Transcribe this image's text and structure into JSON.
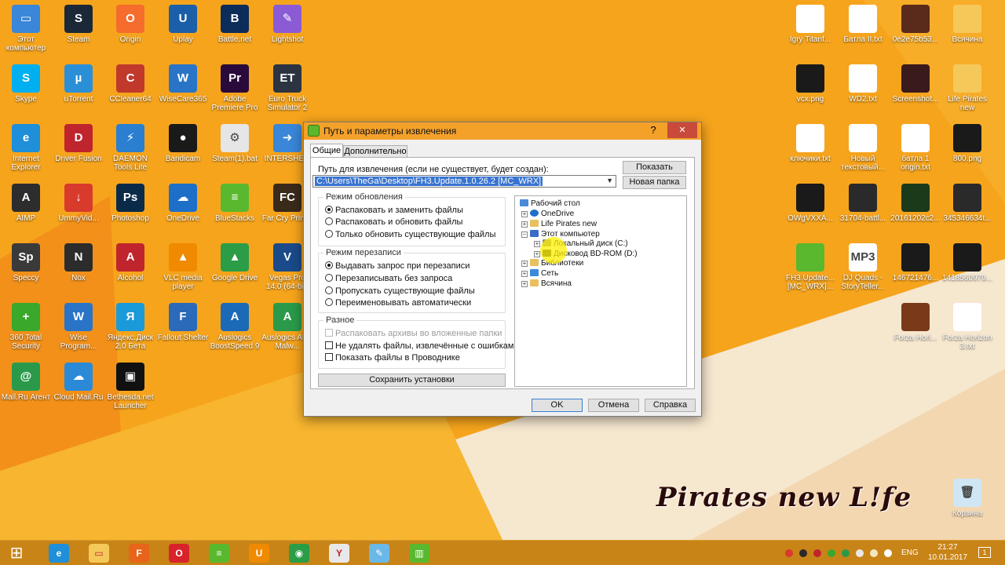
{
  "desktop": {
    "left_icons": [
      {
        "label": "Этот компьютер",
        "color": "#3a86d8",
        "glyph": "▭"
      },
      {
        "label": "Steam",
        "color": "#1b2838",
        "glyph": "S"
      },
      {
        "label": "Origin",
        "color": "#f56c2d",
        "glyph": "O"
      },
      {
        "label": "Uplay",
        "color": "#1a5fa8",
        "glyph": "U"
      },
      {
        "label": "Battle.net",
        "color": "#0c2c5a",
        "glyph": "B"
      },
      {
        "label": "Lightshot",
        "color": "#8b5bd6",
        "glyph": "✎"
      },
      {
        "label": "Skype",
        "color": "#00aff0",
        "glyph": "S"
      },
      {
        "label": "uTorrent",
        "color": "#2b8fd8",
        "glyph": "µ"
      },
      {
        "label": "CCleaner64",
        "color": "#c0392b",
        "glyph": "C"
      },
      {
        "label": "WiseCare365",
        "color": "#2a74c8",
        "glyph": "W"
      },
      {
        "label": "Adobe Premiere Pro",
        "color": "#2a0a3a",
        "glyph": "Pr"
      },
      {
        "label": "Euro Truck Simulator 2",
        "color": "#2b3440",
        "glyph": "ET"
      },
      {
        "label": "Internet Explorer",
        "color": "#1e8fd8",
        "glyph": "e"
      },
      {
        "label": "Driver Fusion",
        "color": "#c0242c",
        "glyph": "D"
      },
      {
        "label": "DAEMON Tools Lite",
        "color": "#2a7fd0",
        "glyph": "⚡"
      },
      {
        "label": "Bandicam",
        "color": "#1a1a1a",
        "glyph": "●"
      },
      {
        "label": "Steam(1).bat",
        "color": "#e6e6e6",
        "glyph": "⚙"
      },
      {
        "label": "INTERSHE...",
        "color": "#3a86d8",
        "glyph": "➜"
      },
      {
        "label": "AIMP",
        "color": "#2d2d2d",
        "glyph": "A"
      },
      {
        "label": "UmmyVid...",
        "color": "#d83a2c",
        "glyph": "↓"
      },
      {
        "label": "Photoshop",
        "color": "#0a2a4a",
        "glyph": "Ps"
      },
      {
        "label": "OneDrive",
        "color": "#1d6fc8",
        "glyph": "☁"
      },
      {
        "label": "BlueStacks",
        "color": "#5ab82e",
        "glyph": "≡"
      },
      {
        "label": "Far Cry Primal",
        "color": "#3a2a1a",
        "glyph": "FC"
      },
      {
        "label": "Speccy",
        "color": "#3a3a3a",
        "glyph": "Sp"
      },
      {
        "label": "Nox",
        "color": "#2c2c2c",
        "glyph": "N"
      },
      {
        "label": "Alcohol",
        "color": "#c0242c",
        "glyph": "A"
      },
      {
        "label": "VLC media player",
        "color": "#f08a00",
        "glyph": "▲"
      },
      {
        "label": "Google Drive",
        "color": "#2a9d46",
        "glyph": "▲"
      },
      {
        "label": "Vegas Pro 14.0 (64-bit)",
        "color": "#1a4a8a",
        "glyph": "V"
      },
      {
        "label": "360 Total Security",
        "color": "#3aa82a",
        "glyph": "+"
      },
      {
        "label": "Wise Program...",
        "color": "#2a74c8",
        "glyph": "W"
      },
      {
        "label": "Яндекс.Диск 2.0 Бета",
        "color": "#1a9ad8",
        "glyph": "Я"
      },
      {
        "label": "Fallout Shelter",
        "color": "#2a6ab8",
        "glyph": "F"
      },
      {
        "label": "Auslogics BoostSpeed 9",
        "color": "#1a6ab8",
        "glyph": "A"
      },
      {
        "label": "Auslogics Anti-Malw...",
        "color": "#2a9a4a",
        "glyph": "A"
      },
      {
        "label": "Mail.Ru Агент",
        "color": "#2a9a4a",
        "glyph": "@"
      },
      {
        "label": "Cloud Mail.Ru",
        "color": "#2a8ad8",
        "glyph": "☁"
      },
      {
        "label": "Bethesda.net Launcher",
        "color": "#111111",
        "glyph": "▣"
      }
    ],
    "right_icons": [
      {
        "label": "Igry Titanf...",
        "color": "#ffffff",
        "glyph": ""
      },
      {
        "label": "Батла II.txt",
        "color": "#ffffff",
        "glyph": ""
      },
      {
        "label": "0e2e75b53...",
        "color": "#5a2a1a",
        "glyph": ""
      },
      {
        "label": "Всячина",
        "color": "#f5c85a",
        "glyph": ""
      },
      {
        "label": "vcx.png",
        "color": "#1a1a1a",
        "glyph": ""
      },
      {
        "label": "WD2.txt",
        "color": "#ffffff",
        "glyph": ""
      },
      {
        "label": "Screenshot...",
        "color": "#3a1a1a",
        "glyph": ""
      },
      {
        "label": "Life Pirates new",
        "color": "#f5c85a",
        "glyph": ""
      },
      {
        "label": "ключики.txt",
        "color": "#ffffff",
        "glyph": ""
      },
      {
        "label": "Новый текстовый...",
        "color": "#ffffff",
        "glyph": ""
      },
      {
        "label": "батла 1 origin.txt",
        "color": "#ffffff",
        "glyph": ""
      },
      {
        "label": "800.png",
        "color": "#1a1a1a",
        "glyph": ""
      },
      {
        "label": "OWgVXXA...",
        "color": "#1a1a1a",
        "glyph": ""
      },
      {
        "label": "31704-battl...",
        "color": "#2a2a2a",
        "glyph": ""
      },
      {
        "label": "20161202c2...",
        "color": "#1a3a1a",
        "glyph": ""
      },
      {
        "label": "345346634t...",
        "color": "#2a2a2a",
        "glyph": ""
      },
      {
        "label": "FH3.Update... [MC_WRX]...",
        "color": "#5ab82e",
        "glyph": ""
      },
      {
        "label": "DJ Quads - StoryTeller...",
        "color": "#ffffff",
        "glyph": "MP3"
      },
      {
        "label": "146721476...",
        "color": "#1a1a1a",
        "glyph": ""
      },
      {
        "label": "1418560979...",
        "color": "#1a1a1a",
        "glyph": ""
      },
      {
        "label": "Forza Hori...",
        "color": "#7a3a1a",
        "glyph": ""
      },
      {
        "label": "Forza Horizon 3.txt",
        "color": "#ffffff",
        "glyph": ""
      },
      {
        "label": "Корзина",
        "color": "#cfe6f5",
        "glyph": "🗑"
      }
    ]
  },
  "dialog": {
    "title": "Путь и параметры извлечения",
    "help_glyph": "?",
    "close_glyph": "✕",
    "tabs": [
      "Общие",
      "Дополнительно"
    ],
    "path_label": "Путь для извлечения (если не существует, будет создан):",
    "path_value": "C:\\Users\\TheGa\\Desktop\\FH3.Update.1.0.26.2 [MC_WRX]",
    "show_button": "Показать",
    "new_folder_button": "Новая папка",
    "update_mode": {
      "title": "Режим обновления",
      "options": [
        "Распаковать и заменить файлы",
        "Распаковать и обновить файлы",
        "Только обновить существующие файлы"
      ],
      "selected": 0
    },
    "overwrite_mode": {
      "title": "Режим перезаписи",
      "options": [
        "Выдавать запрос при перезаписи",
        "Перезаписывать без запроса",
        "Пропускать существующие файлы",
        "Переименовывать автоматически"
      ],
      "selected": 0
    },
    "misc": {
      "title": "Разное",
      "options": [
        "Распаковать архивы во вложенные папки",
        "Не удалять файлы, извлечённые с ошибками",
        "Показать файлы в Проводнике"
      ]
    },
    "save_button": "Сохранить установки",
    "tree": [
      "Рабочий стол",
      "OneDrive",
      "Life Pirates new",
      "Этот компьютер",
      "Локальный диск (C:)",
      "Дисковод BD-ROM (D:)",
      "Библиотеки",
      "Сеть",
      "Всячина"
    ],
    "ok_button": "OK",
    "cancel_button": "Отмена",
    "help_button": "Справка"
  },
  "taskbar": {
    "start_glyph": "⊞",
    "apps": [
      {
        "name": "internet-explorer",
        "color": "#1e8fd8",
        "glyph": "e"
      },
      {
        "name": "file-explorer",
        "color": "#f5c85a",
        "glyph": "▭"
      },
      {
        "name": "firefox",
        "color": "#e8641a",
        "glyph": "F"
      },
      {
        "name": "opera",
        "color": "#d8232a",
        "glyph": "O"
      },
      {
        "name": "bluestacks",
        "color": "#5ab82e",
        "glyph": "≡"
      },
      {
        "name": "uc-browser",
        "color": "#f08a00",
        "glyph": "U"
      },
      {
        "name": "chrome",
        "color": "#2a9d46",
        "glyph": "◉"
      },
      {
        "name": "yandex",
        "color": "#e8e8e8",
        "glyph": "Y"
      },
      {
        "name": "notepad",
        "color": "#6ab8e8",
        "glyph": "✎"
      },
      {
        "name": "winrar-archive",
        "color": "#5ab82e",
        "glyph": "▥"
      }
    ],
    "lang": "ENG",
    "time": "21:27",
    "date": "10.01.2017",
    "notif_count": "1"
  },
  "watermark": "Pirates new L!fe"
}
